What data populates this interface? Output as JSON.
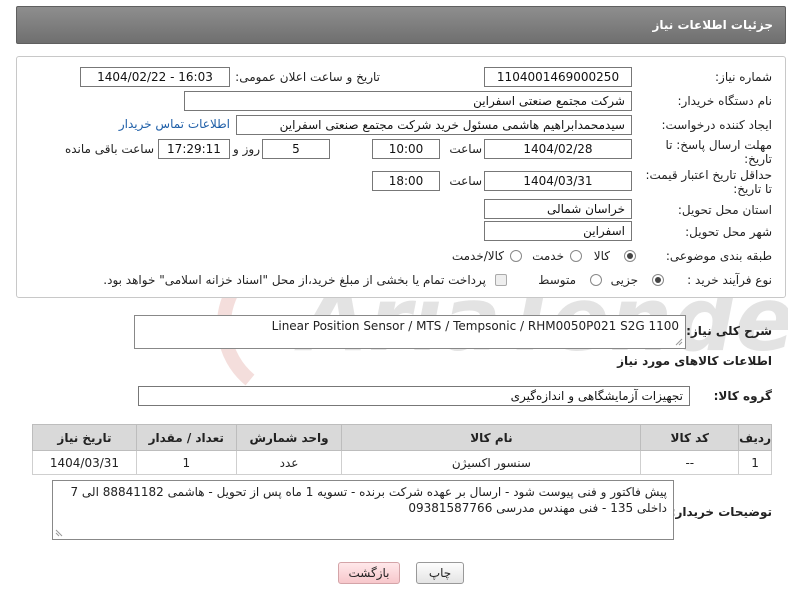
{
  "header": {
    "title": "جزئیات اطلاعات نیاز"
  },
  "form": {
    "need_number_label": "شماره نیاز:",
    "need_number": "1104001469000250",
    "announce_label": "تاریخ و ساعت اعلان عمومی:",
    "announce_value": "1404/02/22 - 16:03",
    "buyer_org_label": "نام دستگاه خریدار:",
    "buyer_org": "شرکت مجتمع صنعتی اسفراین",
    "requester_label": "ایجاد کننده درخواست:",
    "requester": "سیدمحمدابراهیم هاشمی مسئول خرید شرکت مجتمع صنعتی اسفراین",
    "contact_link": "اطلاعات تماس خریدار",
    "deadline_label_1": "مهلت ارسال پاسخ: تا",
    "deadline_label_2": "تاریخ:",
    "deadline_date": "1404/02/28",
    "time_label": "ساعت",
    "deadline_time": "10:00",
    "days_value": "5",
    "days_label": "روز و",
    "remaining_time": "17:29:11",
    "remaining_label": "ساعت باقی مانده",
    "min_price_label_1": "حداقل تاریخ اعتبار قیمت:",
    "min_price_label_2": "تا تاریخ:",
    "min_price_date": "1404/03/31",
    "min_price_time_label": "ساعت",
    "min_price_time": "18:00",
    "province_label": "استان محل تحویل:",
    "province": "خراسان شمالی",
    "city_label": "شهر محل تحویل:",
    "city": "اسفراین",
    "category_label": "طبقه بندی موضوعی:",
    "category_options": [
      "کالا",
      "خدمت",
      "کالا/خدمت"
    ],
    "process_label": "نوع فرآیند خرید :",
    "process_options": [
      "جزیی",
      "متوسط"
    ],
    "payment_note": "پرداخت تمام یا بخشی از مبلغ خرید،از محل \"اسناد خزانه اسلامی\" خواهد بود."
  },
  "description": {
    "label": "شرح کلی نیاز:",
    "value": "Linear Position Sensor / MTS / Tempsonic / RHM0050P021 S2G 1100"
  },
  "goods": {
    "section_title": "اطلاعات کالاهای مورد نیاز",
    "group_label": "گروه کالا:",
    "group_value": "تجهیزات آزمایشگاهی و اندازه‌گیری",
    "columns": [
      "ردیف",
      "کد کالا",
      "نام کالا",
      "واحد شمارش",
      "تعداد / مقدار",
      "تاریخ نیاز"
    ],
    "rows": [
      {
        "row": "1",
        "code": "--",
        "name": "سنسور اکسیژن",
        "unit": "عدد",
        "qty": "1",
        "date": "1404/03/31"
      }
    ]
  },
  "buyer_notes": {
    "label": "توضیحات خریدار:",
    "text": "پیش فاکتور و فنی پیوست شود - ارسال بر عهده شرکت برنده - تسویه 1 ماه پس از تحویل - هاشمی 88841182 الی 7 داخلی 135 - فنی مهندس مدرسی 09381587766"
  },
  "buttons": {
    "print": "چاپ",
    "back": "بازگشت"
  },
  "watermark_text": "AriaTender.neT",
  "colors": {
    "header": "#7f7f7f",
    "link": "#1f5fa8",
    "back_button": "#f7c7cb"
  }
}
